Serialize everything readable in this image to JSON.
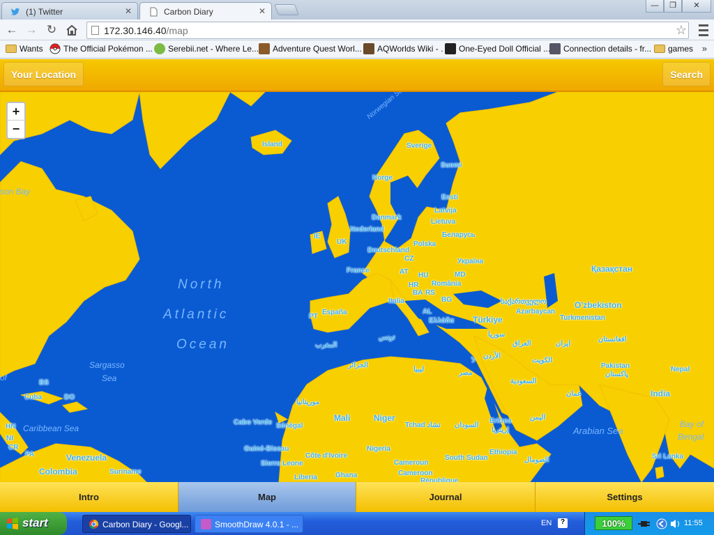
{
  "browser": {
    "tabs": [
      {
        "title": "(1) Twitter",
        "icon": "twitter-icon",
        "active": false
      },
      {
        "title": "Carbon Diary",
        "icon": "page-icon",
        "active": true
      }
    ],
    "window_controls": {
      "minimize": "—",
      "maximize": "❐",
      "close": "✕"
    },
    "url": {
      "host": "172.30.146.40",
      "path": "/map"
    },
    "bookmarks": [
      {
        "label": "Wants",
        "icon": "folder-icon"
      },
      {
        "label": "The Official Pokémon ...",
        "icon": "pokeball-icon"
      },
      {
        "label": "Serebii.net - Where Le...",
        "icon": "serebii-icon"
      },
      {
        "label": "Adventure Quest Worl...",
        "icon": "aqw-icon"
      },
      {
        "label": "AQWorlds Wiki - .",
        "icon": "wiki-icon"
      },
      {
        "label": "One-Eyed Doll Official ...",
        "icon": "doll-icon"
      },
      {
        "label": "Connection details - fr...",
        "icon": "connection-icon"
      },
      {
        "label": "games",
        "icon": "folder-icon"
      }
    ],
    "bookmarks_more": "»"
  },
  "app": {
    "topbar": {
      "left_button": "Your Location",
      "right_button": "Search"
    },
    "zoom": {
      "in": "+",
      "out": "−"
    },
    "map_labels": [
      {
        "text": "Island"
      },
      {
        "text": "Sverige"
      },
      {
        "text": "Suomi"
      },
      {
        "text": "Norge"
      },
      {
        "text": "Eesti"
      },
      {
        "text": "Latvija"
      },
      {
        "text": "Lietuva"
      },
      {
        "text": "Danmark"
      },
      {
        "text": "Nederland"
      },
      {
        "text": "IE"
      },
      {
        "text": "UK"
      },
      {
        "text": "Беларусь"
      },
      {
        "text": "Deutschland"
      },
      {
        "text": "Polska"
      },
      {
        "text": "CZ"
      },
      {
        "text": "Україна"
      },
      {
        "text": "France"
      },
      {
        "text": "AT"
      },
      {
        "text": "HU"
      },
      {
        "text": "MD"
      },
      {
        "text": "România"
      },
      {
        "text": "HR"
      },
      {
        "text": "BA"
      },
      {
        "text": "RS"
      },
      {
        "text": "Italia"
      },
      {
        "text": "BG"
      },
      {
        "text": "España"
      },
      {
        "text": "PT"
      },
      {
        "text": "AL"
      },
      {
        "text": "Ελλάδα"
      },
      {
        "text": "Türkiye"
      },
      {
        "text": "Azərbaycan"
      },
      {
        "text": "Қазақстан"
      },
      {
        "text": "O'zbekiston"
      },
      {
        "text": "Turkmenistan"
      },
      {
        "text": "ایران"
      },
      {
        "text": "العراق"
      },
      {
        "text": "سوريا"
      },
      {
        "text": "الأردن"
      },
      {
        "text": "السعودية"
      },
      {
        "text": "الكويت"
      },
      {
        "text": "عمان"
      },
      {
        "text": "اليمن"
      },
      {
        "text": "Pakistan"
      },
      {
        "text": "پاکستان"
      },
      {
        "text": "افغانستان"
      },
      {
        "text": "Nepal"
      },
      {
        "text": "India"
      },
      {
        "text": "Sri Lanka"
      },
      {
        "text": "مصر"
      },
      {
        "text": "ليبيا"
      },
      {
        "text": "الجزائر"
      },
      {
        "text": "المغرب"
      },
      {
        "text": "تونس"
      },
      {
        "text": "موريتانيا"
      },
      {
        "text": "Mali"
      },
      {
        "text": "Niger"
      },
      {
        "text": "Tchad تشاد"
      },
      {
        "text": "السودان"
      },
      {
        "text": "Eritrea"
      },
      {
        "text": "إريتريا"
      },
      {
        "text": "Ethiopia"
      },
      {
        "text": "South Sudan"
      },
      {
        "text": "Nigeria"
      },
      {
        "text": "Cameroun"
      },
      {
        "text": "Cameroon"
      },
      {
        "text": "République"
      },
      {
        "text": "Sénégal"
      },
      {
        "text": "Cabo Verde"
      },
      {
        "text": "Guiné-Bissau"
      },
      {
        "text": "Sierra Leone"
      },
      {
        "text": "Côte d'Ivoire"
      },
      {
        "text": "Liberia"
      },
      {
        "text": "Ghana"
      },
      {
        "text": "الصومال"
      },
      {
        "text": "BS"
      },
      {
        "text": "Cuba"
      },
      {
        "text": "DO"
      },
      {
        "text": "HN"
      },
      {
        "text": "NI"
      },
      {
        "text": "CR"
      },
      {
        "text": "PA"
      },
      {
        "text": "Venezuela"
      },
      {
        "text": "Colombia"
      },
      {
        "text": "Suriname"
      },
      {
        "text": "ל"
      },
      {
        "text": "საქართველო"
      }
    ],
    "sea_labels": [
      {
        "text": "North"
      },
      {
        "text": "Atlantic"
      },
      {
        "text": "Ocean"
      },
      {
        "text": "Sargasso"
      },
      {
        "text": "Sea"
      },
      {
        "text": "Caribbean Sea"
      },
      {
        "text": "Arabian Sea"
      },
      {
        "text": "Bay of"
      },
      {
        "text": "Bengal"
      },
      {
        "text": "son Bay"
      },
      {
        "text": "of"
      },
      {
        "text": "Norwegian Sea"
      }
    ],
    "bottom_nav": [
      {
        "label": "Intro",
        "selected": false
      },
      {
        "label": "Map",
        "selected": true
      },
      {
        "label": "Journal",
        "selected": false
      },
      {
        "label": "Settings",
        "selected": false
      }
    ],
    "colors": {
      "sea": "#0a5bd2",
      "land": "#f8cf00",
      "label": "#3fb1ef",
      "topbar": "#f4bb00"
    }
  },
  "taskbar": {
    "start": "start",
    "tasks": [
      {
        "label": "Carbon Diary - Googl...",
        "icon": "chrome-icon"
      },
      {
        "label": "SmoothDraw 4.0.1 - ...",
        "icon": "smoothdraw-icon"
      }
    ],
    "language": "EN",
    "help": "?",
    "battery": "100%",
    "clock": "11:55"
  }
}
